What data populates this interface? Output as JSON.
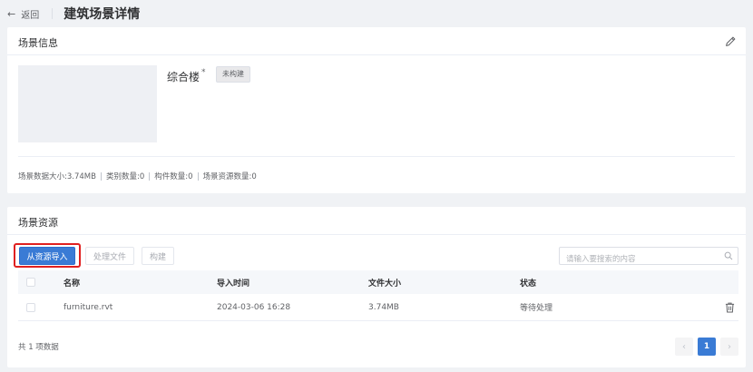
{
  "header": {
    "back_label": "返回",
    "title": "建筑场景详情"
  },
  "scene_info": {
    "title": "场景信息",
    "name": "综合楼",
    "required_mark": "*",
    "status": "未构建",
    "stats": [
      "场景数据大小:3.74MB",
      "类别数量:0",
      "构件数量:0",
      "场景资源数量:0"
    ]
  },
  "resources": {
    "title": "场景资源",
    "import_label": "从资源导入",
    "process_label": "处理文件",
    "build_label": "构建",
    "search_placeholder": "请输入要搜索的内容",
    "columns": [
      "名称",
      "导入时间",
      "文件大小",
      "状态"
    ],
    "rows": [
      {
        "name": "furniture.rvt",
        "time": "2024-03-06 16:28",
        "size": "3.74MB",
        "status": "等待处理"
      }
    ],
    "total": "共 1 项数据",
    "current_page": "1"
  },
  "icons": {
    "back": "arrow-left-icon",
    "edit": "pencil-icon",
    "search": "search-icon",
    "delete": "trash-icon",
    "prev": "chevron-left-icon",
    "next": "chevron-right-icon"
  },
  "colors": {
    "primary": "#3a7bd5",
    "highlight": "#e02020",
    "background": "#f0f2f5"
  }
}
